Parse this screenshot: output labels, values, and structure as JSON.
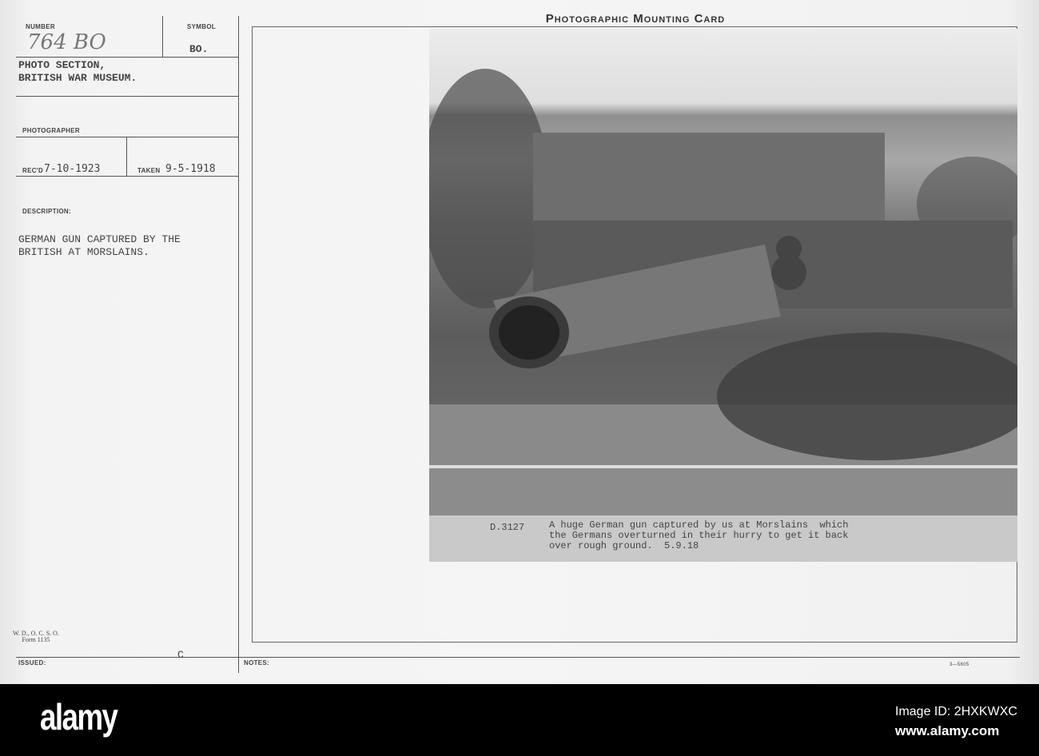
{
  "card": {
    "title": "Photographic Mounting Card",
    "number_label": "NUMBER",
    "number_value": "764 BO",
    "symbol_label": "SYMBOL",
    "symbol_value": "BO.",
    "source": "PHOTO SECTION,\nBRITISH WAR MUSEUM.",
    "photographer_label": "PHOTOGRAPHER",
    "recd_label": "REC'D",
    "recd_value": "7-10-1923",
    "taken_label": "TAKEN",
    "taken_value": "9-5-1918",
    "description_label": "DESCRIPTION:",
    "description": "GERMAN GUN CAPTURED BY THE\nBRITISH AT MORSLAINS.",
    "form": "W. D., O. C. S. O.\nForm 1135",
    "issued_label": "ISSUED:",
    "issued_mark": "C",
    "notes_label": "NOTES:",
    "print_code": "3—5605"
  },
  "photo": {
    "caption_id": "D.3127",
    "caption": "A huge German gun captured by us at Morslains  which\nthe Germans overturned in their hurry to get it back\nover rough ground.  5.9.18"
  },
  "footer": {
    "brand": "alamy",
    "image_id": "Image ID: 2HXKWXC",
    "url": "www.alamy.com"
  }
}
